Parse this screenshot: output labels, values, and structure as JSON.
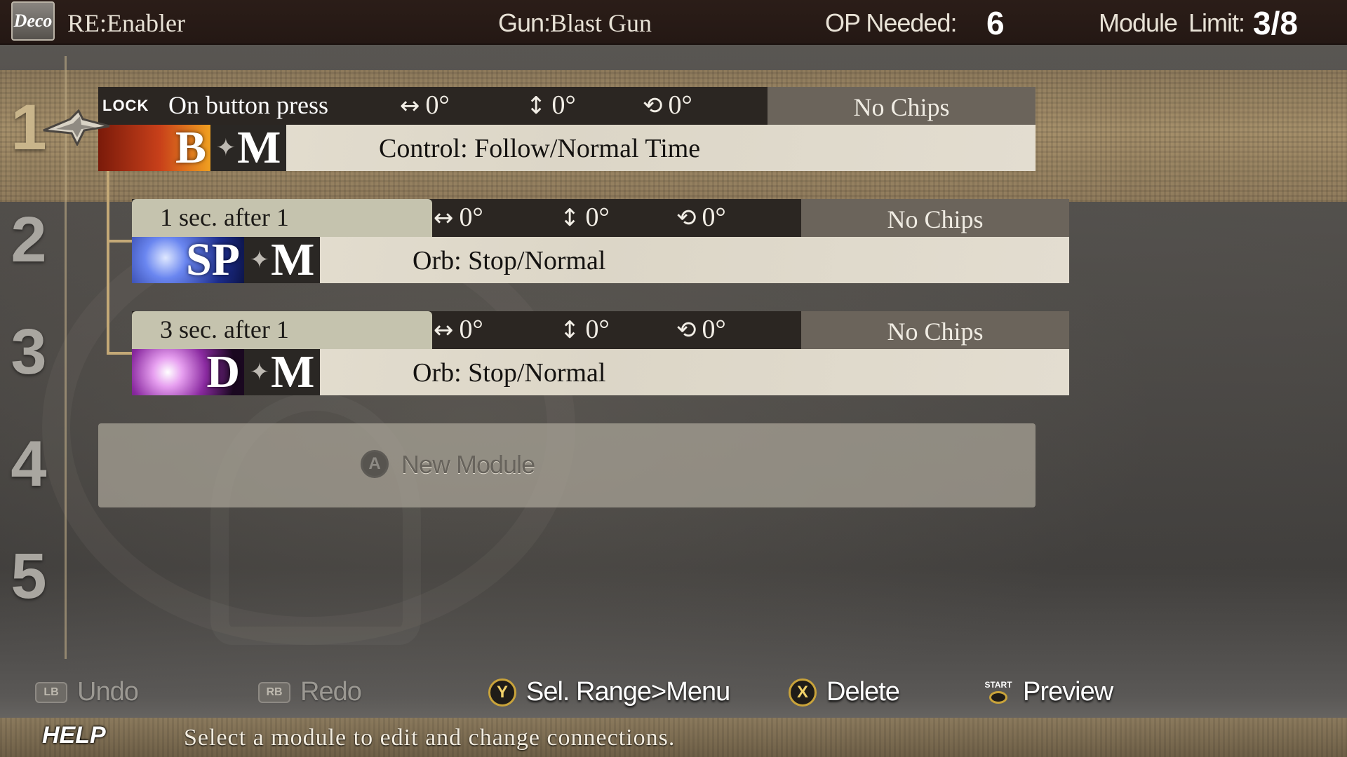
{
  "header": {
    "deco_badge": "Deco",
    "title": "RE:Enabler",
    "gun_label": "Gun:",
    "gun_value": "Blast Gun",
    "op_label": "OP Needed:",
    "op_value": "6",
    "module_label": "Module",
    "limit_label": "Limit:",
    "limit_value": "3/8"
  },
  "row_numbers": [
    "1",
    "2",
    "3",
    "4",
    "5"
  ],
  "modules": [
    {
      "trigger": "On button press",
      "lock_tag": "LOCK",
      "h_angle": "0°",
      "v_angle": "0°",
      "r_angle": "0°",
      "chips": "No Chips",
      "bullet_type": "B",
      "bullet_mod": "M",
      "description": "Control: Follow/Normal Time"
    },
    {
      "trigger": "1  sec.  after  1",
      "h_angle": "0°",
      "v_angle": "0°",
      "r_angle": "0°",
      "chips": "No Chips",
      "bullet_type": "SP",
      "bullet_mod": "M",
      "description": "Orb: Stop/Normal"
    },
    {
      "trigger": "3  sec.  after  1",
      "h_angle": "0°",
      "v_angle": "0°",
      "r_angle": "0°",
      "chips": "No Chips",
      "bullet_type": "D",
      "bullet_mod": "M",
      "description": "Orb: Stop/Normal"
    }
  ],
  "new_module": {
    "button": "A",
    "label": "New Module"
  },
  "controls": [
    {
      "button": "LB",
      "label": "Undo"
    },
    {
      "button": "RB",
      "label": "Redo"
    },
    {
      "button": "Y",
      "label": "Sel. Range>Menu"
    },
    {
      "button": "X",
      "label": "Delete"
    },
    {
      "button": "START",
      "label": "Preview"
    }
  ],
  "help": {
    "tag": "HELP",
    "text": "Select  a  module  to  edit  and  change  connections."
  },
  "colors": {
    "gold_band": "#a58f6a",
    "button_ring": "#c9a33a",
    "bullet_b": "#e8a020",
    "bullet_sp": "#3a5ad8",
    "bullet_d": "#c060d0"
  }
}
